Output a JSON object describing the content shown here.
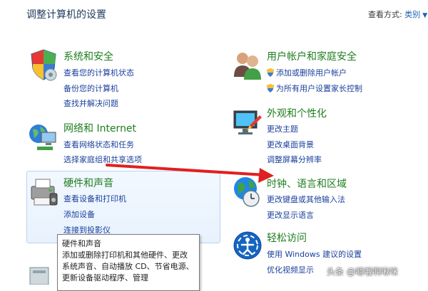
{
  "header": {
    "title": "调整计算机的设置",
    "view_by_label": "查看方式:",
    "view_by_value": "类别"
  },
  "categories": {
    "system_security": {
      "title": "系统和安全",
      "links": [
        "查看您的计算机状态",
        "备份您的计算机",
        "查找并解决问题"
      ],
      "icon": "shield-icon"
    },
    "network": {
      "title": "网络和 Internet",
      "links": [
        "查看网络状态和任务",
        "选择家庭组和共享选项"
      ],
      "icon": "network-icon"
    },
    "hardware": {
      "title": "硬件和声音",
      "links": [
        "查看设备和打印机",
        "添加设备",
        "连接到投影仪"
      ],
      "icon": "printer-icon"
    },
    "user_accounts": {
      "title": "用户帐户和家庭安全",
      "links": [
        "添加或删除用户帐户",
        "为所有用户设置家长控制"
      ],
      "icon": "users-icon"
    },
    "appearance": {
      "title": "外观和个性化",
      "links": [
        "更改主题",
        "更改桌面背景",
        "调整屏幕分辨率"
      ],
      "icon": "monitor-paint-icon"
    },
    "clock_region": {
      "title": "时钟、语言和区域",
      "links": [
        "更改键盘或其他输入法",
        "更改显示语言"
      ],
      "icon": "globe-clock-icon"
    },
    "ease_of_access": {
      "title": "轻松访问",
      "links": [
        "使用 Windows 建议的设置",
        "优化视频显示"
      ],
      "icon": "ease-of-access-icon"
    }
  },
  "tooltip": {
    "title": "硬件和声音",
    "body": "添加或删除打印机和其他硬件、更改系统声音、自动播放 CD、节省电源、更新设备驱动程序、管理"
  },
  "watermark": "头条 @嗯哦啊啾咪",
  "colors": {
    "title_green": "#1e7d1e",
    "link_blue": "#1a3f9c",
    "arrow_red": "#e02020"
  }
}
